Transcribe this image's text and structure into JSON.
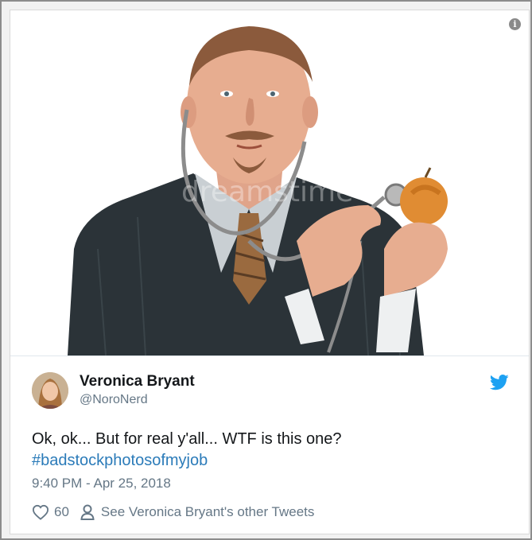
{
  "tweet": {
    "author_name": "Veronica Bryant",
    "author_handle": "@NoroNerd",
    "text": "Ok, ok... But for real y'all... WTF is this one?",
    "hashtag": "#badstockphotosofmyjob",
    "timestamp": "9:40 PM - Apr 25, 2018",
    "like_count": "60",
    "other_tweets_label": "See Veronica Bryant's other Tweets"
  },
  "media": {
    "watermark": "dreamstime",
    "description_icon": "info-icon"
  },
  "icons": {
    "bird": "twitter-bird-icon",
    "like": "heart-icon",
    "profile": "person-icon"
  },
  "colors": {
    "twitter_blue": "#1da1f2",
    "hashtag": "#2b7bb9",
    "muted_text": "#657786",
    "primary_text": "#14171a"
  }
}
